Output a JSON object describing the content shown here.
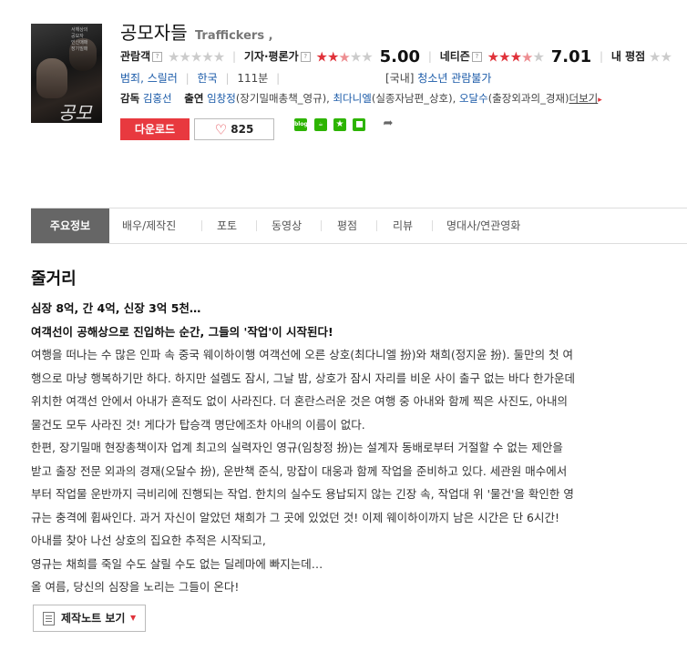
{
  "movie": {
    "title_ko": "공모자들",
    "title_en": "Traffickers ,",
    "poster_text": "공모",
    "poster_tagline": "서해상의\n공모자\n인신매매\n장기밀매"
  },
  "ratings": {
    "audience_label": "관람객",
    "audience_stars": 0,
    "critic_label": "기자·평론가",
    "critic_stars": 2.5,
    "critic_score": "5.00",
    "netizen_label": "네티즌",
    "netizen_stars": 3.5,
    "netizen_score": "7.01",
    "my_label": "내 평점"
  },
  "info": {
    "genre": "범죄, 스릴러",
    "country": "한국",
    "runtime": "111분",
    "rating_prefix": "[국내]",
    "rating": "청소년 관람불가",
    "director_label": "감독",
    "director": "김홍선",
    "cast_label": "출연",
    "cast1": "임창정",
    "cast1_role": "(장기밀매총책_영규),",
    "cast2": "최다니엘",
    "cast2_role": "(실종자남편_상호),",
    "cast3": "오달수",
    "cast3_role": "(출장외과의_경재)",
    "more": "더보기"
  },
  "actions": {
    "download": "다운로드",
    "like_count": "825"
  },
  "share_icons": [
    {
      "name": "blog-share-icon",
      "color": "#2db400",
      "text": "blog"
    },
    {
      "name": "cafe-share-icon",
      "color": "#2db400",
      "text": "cafe"
    },
    {
      "name": "bookmark-share-icon",
      "color": "#2db400",
      "text": "★"
    },
    {
      "name": "band-share-icon",
      "color": "#2db400",
      "text": ""
    }
  ],
  "tabs": [
    "주요정보",
    "배우/제작진",
    "포토",
    "동영상",
    "평점",
    "리뷰",
    "명대사/연관영화"
  ],
  "synopsis": {
    "heading": "줄거리",
    "bold1": "심장 8억, 간 4억, 신장 3억 5천…",
    "bold2": "여객선이 공해상으로 진입하는 순간, 그들의 '작업'이 시작된다!",
    "lines": [
      "여행을 떠나는 수 많은 인파 속 중국 웨이하이행 여객선에 오른 상호(최다니엘 扮)와 채희(정지윤 扮). 둘만의 첫 여",
      "행으로 마냥 행복하기만 하다. 하지만 설렘도 잠시, 그날 밤, 상호가 잠시 자리를 비운 사이 출구 없는 바다 한가운데",
      "위치한 여객선 안에서 아내가 흔적도 없이 사라진다. 더 혼란스러운 것은 여행 중 아내와 함께 찍은 사진도, 아내의",
      "물건도 모두 사라진 것! 게다가 탑승객 명단에조차 아내의 이름이 없다.",
      " 한편, 장기밀매 현장총책이자 업계 최고의 실력자인 영규(임창정 扮)는 설계자 동배로부터 거절할 수 없는 제안을",
      "받고 출장 전문 외과의 경재(오달수 扮), 운반책 준식, 망잡이 대웅과 함께 작업을 준비하고 있다. 세관원 매수에서",
      "부터 작업물 운반까지 극비리에 진행되는 작업. 한치의 실수도 용납되지 않는 긴장 속, 작업대 위 '물건'을 확인한 영",
      "규는 충격에 휩싸인다. 과거 자신이 알았던 채희가 그 곳에 있었던 것! 이제 웨이하이까지 남은 시간은 단 6시간!",
      " 아내를 찾아 나선 상호의 집요한 추적은 시작되고,",
      " 영규는 채희를 죽일 수도 살릴 수도 없는 딜레마에 빠지는데…",
      " 올 여름, 당신의 심장을 노리는 그들이 온다!"
    ]
  },
  "notes_button": "제작노트 보기"
}
